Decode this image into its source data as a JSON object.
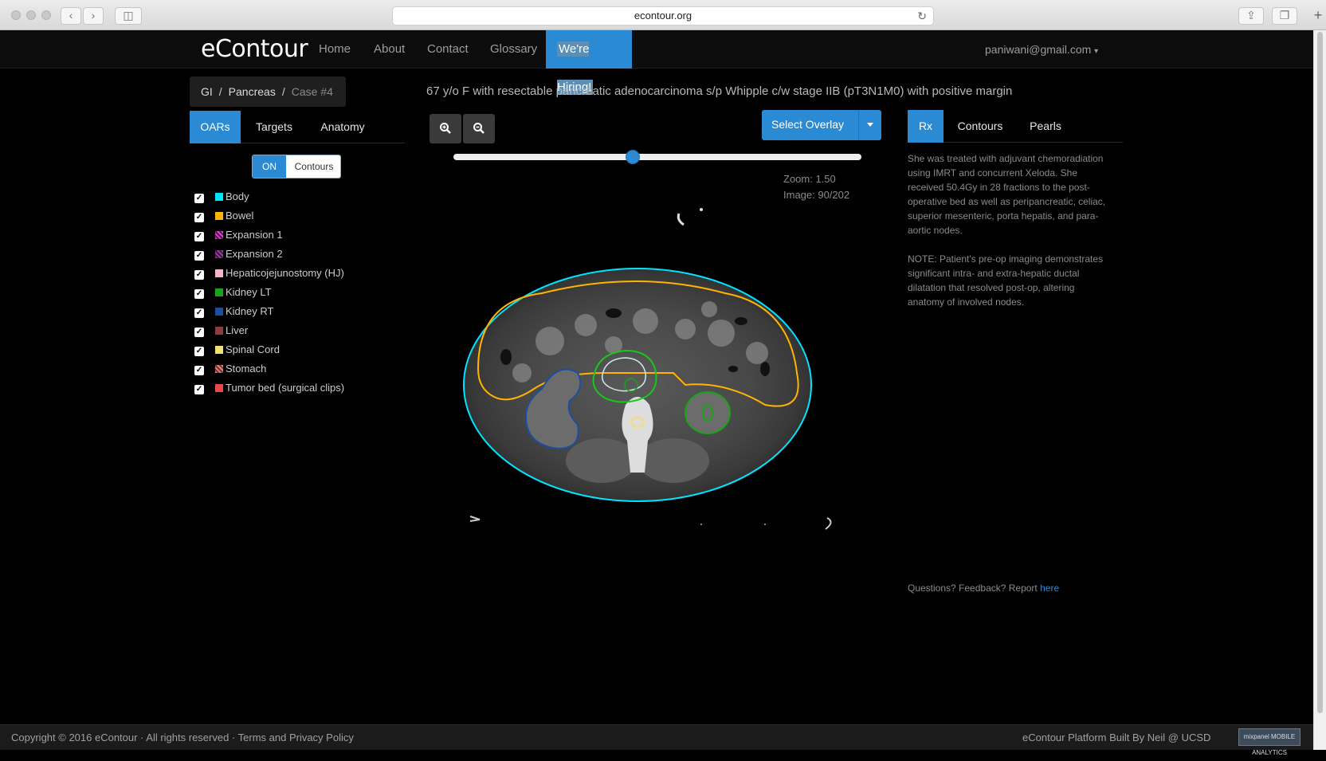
{
  "browser": {
    "url": "econtour.org"
  },
  "nav": {
    "logo": "eContour",
    "links": [
      "Home",
      "About",
      "Contact",
      "Glossary"
    ],
    "hiring": "We're Hiring!",
    "user": "paniwani@gmail.com"
  },
  "breadcrumb": {
    "items": [
      "GI",
      "Pancreas",
      "Case #4"
    ],
    "separator": "/"
  },
  "case_title": "67 y/o F with resectable pancreatic adenocarcinoma s/p Whipple c/w stage IIB (pT3N1M0) with positive margin",
  "left_tabs": [
    "OARs",
    "Targets",
    "Anatomy"
  ],
  "toggle": {
    "on": "ON",
    "off": "Contours"
  },
  "organs": [
    {
      "label": "Body",
      "color": "#00e5ff",
      "checked": true
    },
    {
      "label": "Bowel",
      "color": "#ffb400",
      "checked": true
    },
    {
      "label": "Expansion 1",
      "color": "#e23fd0",
      "checked": true
    },
    {
      "label": "Expansion 2",
      "color": "#9b3c9e",
      "checked": true
    },
    {
      "label": "Hepaticojejunostomy (HJ)",
      "color": "#f3b6c8",
      "checked": true
    },
    {
      "label": "Kidney LT",
      "color": "#18a318",
      "checked": true
    },
    {
      "label": "Kidney RT",
      "color": "#1a4fa0",
      "checked": true
    },
    {
      "label": "Liver",
      "color": "#8c3c3c",
      "checked": true
    },
    {
      "label": "Spinal Cord",
      "color": "#f0e070",
      "checked": true
    },
    {
      "label": "Stomach",
      "color": "#e8807a",
      "checked": true
    },
    {
      "label": "Tumor bed (surgical clips)",
      "color": "#e84a4a",
      "checked": true
    }
  ],
  "viewer": {
    "zoom_in_icon": "zoom-in-icon",
    "zoom_out_icon": "zoom-out-icon",
    "select_overlay": "Select Overlay",
    "slider_value": 0.44,
    "zoom_text": "Zoom: 1.50",
    "image_text": "Image: 90/202"
  },
  "right_tabs": [
    "Rx",
    "Contours",
    "Pearls"
  ],
  "rx": {
    "paragraph1": "She was treated with adjuvant chemoradiation using IMRT and concurrent Xeloda. She received 50.4Gy in 28 fractions to the post-operative bed as well as peripancreatic, celiac, superior mesenteric, porta hepatis, and para-aortic nodes.",
    "paragraph2": "NOTE: Patient's pre-op imaging demonstrates significant intra- and extra-hepatic ductal dilatation that resolved post-op, altering anatomy of involved nodes."
  },
  "feedback": {
    "text": "Questions? Feedback? Report ",
    "link": "here"
  },
  "footer": {
    "copyright": "Copyright © 2016 eContour · All rights reserved · Terms and Privacy Policy",
    "built_by": "eContour Platform Built By Neil @ UCSD",
    "badge": "mixpanel MOBILE ANALYTICS"
  }
}
